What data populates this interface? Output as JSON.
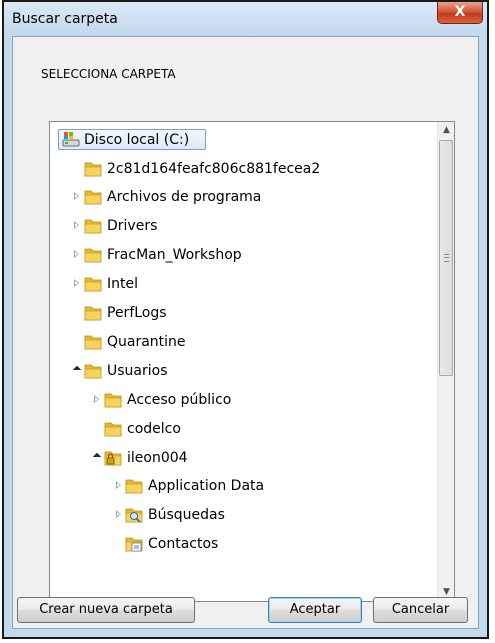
{
  "window": {
    "title": "Buscar carpeta",
    "close_glyph": "X"
  },
  "prompt": "SELECCIONA CARPETA",
  "tree": {
    "root": {
      "label": "Disco local (C:)",
      "icon": "drive-icon"
    },
    "items": [
      {
        "label": "2c81d164feafc806c881fecea2",
        "level": 1,
        "expander": "none",
        "icon": "folder-icon"
      },
      {
        "label": "Archivos de programa",
        "level": 1,
        "expander": "collapsed",
        "icon": "folder-icon"
      },
      {
        "label": "Drivers",
        "level": 1,
        "expander": "collapsed",
        "icon": "folder-icon"
      },
      {
        "label": "FracMan_Workshop",
        "level": 1,
        "expander": "collapsed",
        "icon": "folder-icon"
      },
      {
        "label": "Intel",
        "level": 1,
        "expander": "collapsed",
        "icon": "folder-icon"
      },
      {
        "label": "PerfLogs",
        "level": 1,
        "expander": "none",
        "icon": "folder-icon"
      },
      {
        "label": "Quarantine",
        "level": 1,
        "expander": "none",
        "icon": "folder-icon"
      },
      {
        "label": "Usuarios",
        "level": 1,
        "expander": "expanded",
        "icon": "folder-icon"
      },
      {
        "label": "Acceso público",
        "level": 2,
        "expander": "collapsed",
        "icon": "folder-icon"
      },
      {
        "label": "codelco",
        "level": 2,
        "expander": "none",
        "icon": "folder-icon"
      },
      {
        "label": "ileon004",
        "level": 2,
        "expander": "expanded",
        "icon": "locked-user-folder-icon"
      },
      {
        "label": "Application Data",
        "level": 3,
        "expander": "collapsed",
        "icon": "folder-icon"
      },
      {
        "label": "Búsquedas",
        "level": 3,
        "expander": "collapsed",
        "icon": "search-folder-icon"
      },
      {
        "label": "Contactos",
        "level": 3,
        "expander": "none",
        "icon": "contacts-folder-icon"
      }
    ]
  },
  "buttons": {
    "new_folder": "Crear nueva carpeta",
    "accept": "Aceptar",
    "cancel": "Cancelar"
  },
  "colors": {
    "frame": "#c3d9ec",
    "client": "#f0f0f0",
    "folder": "#f0c948",
    "selection_border": "#7da2ce"
  }
}
